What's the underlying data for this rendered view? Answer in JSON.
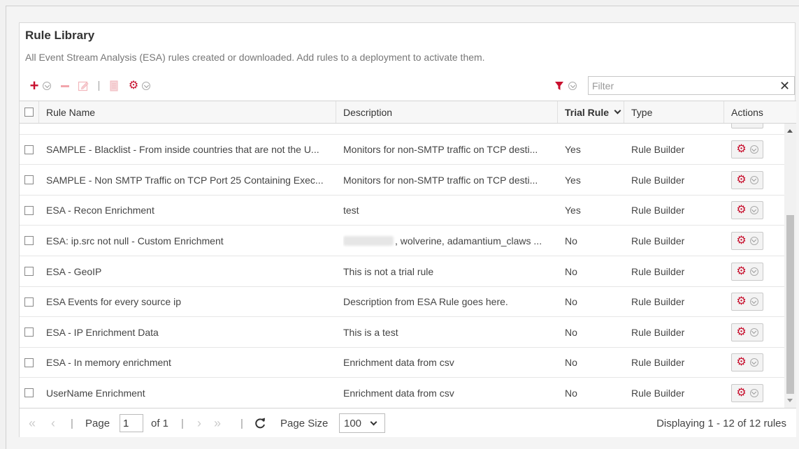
{
  "panel": {
    "title": "Rule Library",
    "description": "All Event Stream Analysis (ESA) rules created or downloaded. Add rules to a deployment to activate them."
  },
  "toolbar": {
    "add_icon": "plus-icon",
    "filter_placeholder": "Filter",
    "clear_glyph": "✕"
  },
  "columns": {
    "rule_name": "Rule Name",
    "description": "Description",
    "trial_rule": "Trial Rule",
    "type": "Type",
    "actions": "Actions"
  },
  "rows": [
    {
      "name": "SAMPLE - Blacklist - From inside countries that are not the U...",
      "description": "Monitors for non-SMTP traffic on TCP desti...",
      "trial": "Yes",
      "type": "Rule Builder"
    },
    {
      "name": "SAMPLE - Non SMTP Traffic on TCP Port 25 Containing Exec...",
      "description": "Monitors for non-SMTP traffic on TCP desti...",
      "trial": "Yes",
      "type": "Rule Builder"
    },
    {
      "name": "ESA - Recon Enrichment",
      "description": "test",
      "trial": "Yes",
      "type": "Rule Builder"
    },
    {
      "name": "ESA: ip.src not null - Custom Enrichment",
      "description": ", wolverine, adamantium_claws ...",
      "trial": "No",
      "type": "Rule Builder"
    },
    {
      "name": "ESA - GeoIP",
      "description": "This is not a trial rule",
      "trial": "No",
      "type": "Rule Builder"
    },
    {
      "name": "ESA Events for every source ip",
      "description": "Description from ESA Rule goes here.",
      "trial": "No",
      "type": "Rule Builder"
    },
    {
      "name": "ESA - IP Enrichment Data",
      "description": "This is a test",
      "trial": "No",
      "type": "Rule Builder"
    },
    {
      "name": "ESA - In memory enrichment",
      "description": "Enrichment data from csv",
      "trial": "No",
      "type": "Rule Builder"
    },
    {
      "name": "UserName Enrichment",
      "description": "Enrichment data from csv",
      "trial": "No",
      "type": "Rule Builder"
    }
  ],
  "pager": {
    "page_label": "Page",
    "page_value": "1",
    "of_label": "of 1",
    "page_size_label": "Page Size",
    "page_size_value": "100",
    "summary": "Displaying 1 - 12 of 12 rules"
  },
  "colors": {
    "accent": "#c8102e",
    "header_bg": "#f7f7f7"
  }
}
